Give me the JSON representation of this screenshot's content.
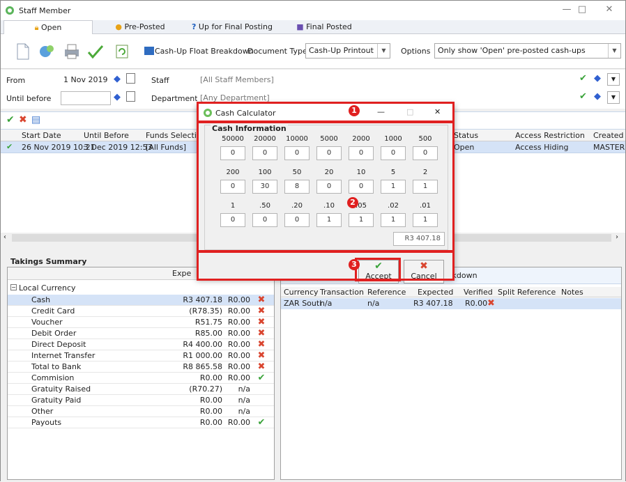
{
  "window": {
    "title": "Staff Member",
    "minimize": "—",
    "maximize": "□",
    "close": "✕"
  },
  "tabs": [
    {
      "label": "Open"
    },
    {
      "label": "Pre-Posted"
    },
    {
      "label": "Up for Final Posting"
    },
    {
      "label": "Final Posted"
    }
  ],
  "toolbar": {
    "cashup_float_label": "Cash-Up Float Breakdown",
    "document_type_label": "Document Type",
    "document_type_value": "Cash-Up Printout",
    "options_label": "Options",
    "options_value": "Only show 'Open' pre-posted cash-ups"
  },
  "filters": {
    "from_label": "From",
    "from_value": "1 Nov 2019",
    "until_label": "Until before",
    "until_value": "",
    "staff_label": "Staff",
    "staff_value": "[All Staff Members]",
    "department_label": "Department",
    "department_value": "[Any Department]"
  },
  "grid": {
    "columns": [
      "Start Date",
      "Until Before",
      "Funds Selection",
      "Status",
      "Access Restriction",
      "Created"
    ],
    "row": {
      "start": "26 Nov 2019 10:21",
      "until": "3 Dec 2019 12:53",
      "funds": "[All Funds]",
      "status": "Open",
      "access": "Access Hiding",
      "created": "MASTER"
    }
  },
  "takings": {
    "title": "Takings Summary",
    "expected_header": "Expe",
    "group": "Local Currency",
    "rows": [
      {
        "name": "Cash",
        "expected": "R3 407.18",
        "verified": "R0.00",
        "icon": "x"
      },
      {
        "name": "Credit Card",
        "expected": "(R78.35)",
        "verified": "R0.00",
        "icon": "x"
      },
      {
        "name": "Voucher",
        "expected": "R51.75",
        "verified": "R0.00",
        "icon": "x"
      },
      {
        "name": "Debit Order",
        "expected": "R85.00",
        "verified": "R0.00",
        "icon": "x"
      },
      {
        "name": "Direct Deposit",
        "expected": "R4 400.00",
        "verified": "R0.00",
        "icon": "x"
      },
      {
        "name": "Internet Transfer",
        "expected": "R1 000.00",
        "verified": "R0.00",
        "icon": "x"
      },
      {
        "name": "Total to Bank",
        "expected": "R8 865.58",
        "verified": "R0.00",
        "icon": "x"
      },
      {
        "name": "Commision",
        "expected": "R0.00",
        "verified": "R0.00",
        "icon": "check"
      },
      {
        "name": "Gratuity Raised",
        "expected": "(R70.27)",
        "verified": "n/a",
        "icon": ""
      },
      {
        "name": "Gratuity Paid",
        "expected": "R0.00",
        "verified": "n/a",
        "icon": ""
      },
      {
        "name": "Other",
        "expected": "R0.00",
        "verified": "n/a",
        "icon": ""
      },
      {
        "name": "Payouts",
        "expected": "R0.00",
        "verified": "R0.00",
        "icon": "check"
      }
    ]
  },
  "breakdown": {
    "title": "eakdown",
    "columns": [
      "Currency",
      "Transaction",
      "Reference",
      "Expected",
      "Verified",
      "Split Reference",
      "Notes"
    ],
    "row": {
      "currency": "ZAR Soutl",
      "transaction": "n/a",
      "reference": "n/a",
      "expected": "R3 407.18",
      "verified": "R0.00"
    }
  },
  "dialog": {
    "title": "Cash Calculator",
    "minimize": "—",
    "maximize": "□",
    "close": "✕",
    "section": "Cash Information",
    "row1": [
      {
        "label": "50000",
        "value": "0"
      },
      {
        "label": "20000",
        "value": "0"
      },
      {
        "label": "10000",
        "value": "0"
      },
      {
        "label": "5000",
        "value": "0"
      },
      {
        "label": "2000",
        "value": "0"
      },
      {
        "label": "1000",
        "value": "0"
      },
      {
        "label": "500",
        "value": "0"
      }
    ],
    "row2": [
      {
        "label": "200",
        "value": "0"
      },
      {
        "label": "100",
        "value": "30"
      },
      {
        "label": "50",
        "value": "8"
      },
      {
        "label": "20",
        "value": "0"
      },
      {
        "label": "10",
        "value": "0"
      },
      {
        "label": "5",
        "value": "1"
      },
      {
        "label": "2",
        "value": "1"
      }
    ],
    "row3": [
      {
        "label": "1",
        "value": "0"
      },
      {
        "label": ".50",
        "value": "0"
      },
      {
        "label": ".20",
        "value": "0"
      },
      {
        "label": ".10",
        "value": "1"
      },
      {
        "label": ".05",
        "value": "1"
      },
      {
        "label": ".02",
        "value": "1"
      },
      {
        "label": ".01",
        "value": "1"
      }
    ],
    "total": "R3 407.18",
    "accept": "Accept",
    "cancel": "Cancel"
  },
  "badges": [
    "1",
    "2",
    "3"
  ],
  "colors": {
    "highlight_red": "#e02020",
    "selection_blue": "#d5e3f7",
    "check_green": "#3aa33a",
    "cross_red": "#d9452f"
  }
}
